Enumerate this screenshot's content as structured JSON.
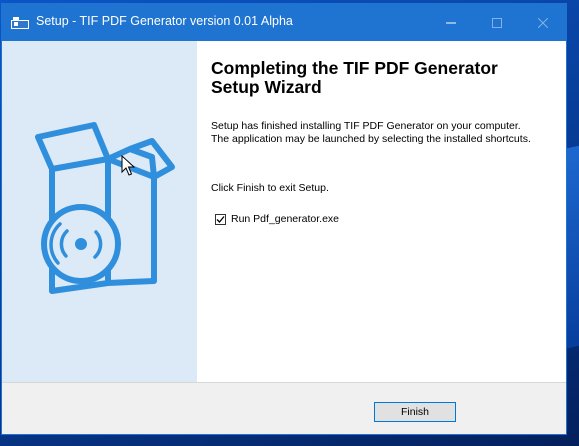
{
  "window": {
    "title": "Setup - TIF PDF Generator version 0.01 Alpha",
    "title_icon": "installer-icon",
    "controls": [
      "minimize-icon",
      "maximize-icon",
      "close-icon"
    ]
  },
  "sidebar": {
    "image": "software-box-with-disc-icon"
  },
  "main": {
    "heading": "Completing the TIF PDF Generator Setup Wizard",
    "description": "Setup has finished installing TIF PDF Generator on your computer. The application may be launched by selecting the installed shortcuts.",
    "instruction": "Click Finish to exit Setup.",
    "run_checkbox": {
      "label": "Run Pdf_generator.exe",
      "checked": true
    }
  },
  "footer": {
    "finish_label": "Finish"
  },
  "colors": {
    "titlebar": "#1e74d0",
    "sidebar_bg": "#dce9f6",
    "accent": "#2f8fdc",
    "button_border": "#0078d7"
  }
}
